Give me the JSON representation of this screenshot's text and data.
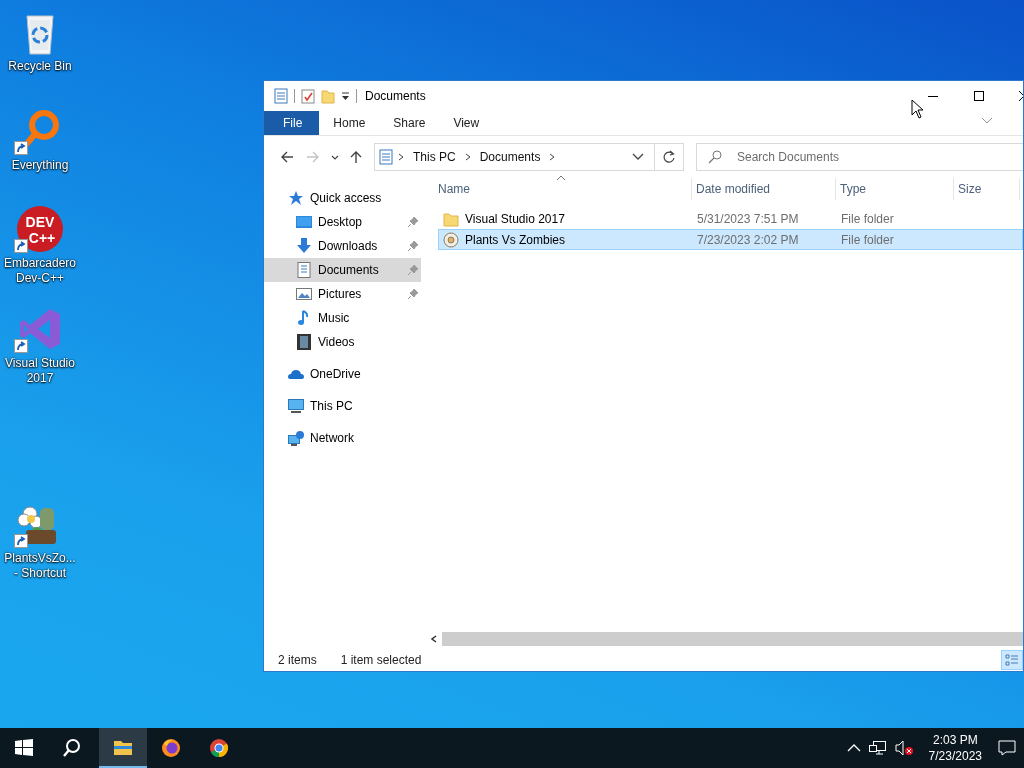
{
  "desktop_icons": [
    {
      "kind": "recycle",
      "label": "Recycle Bin",
      "shortcut": false
    },
    {
      "kind": "ring",
      "label": "Everything",
      "shortcut": true
    },
    {
      "kind": "devcpp",
      "label": "Embarcadero Dev-C++",
      "shortcut": true,
      "logo_text": [
        "DEV",
        "C++"
      ]
    },
    {
      "kind": "vs",
      "label": "Visual Studio 2017",
      "shortcut": true
    },
    {
      "kind": "game",
      "label": "PlantsVsZo... - Shortcut",
      "shortcut": true
    }
  ],
  "explorer": {
    "title": "Documents",
    "ribbon_tabs": [
      {
        "kind": "file",
        "label": "File"
      },
      {
        "kind": "tab",
        "label": "Home"
      },
      {
        "kind": "tab",
        "label": "Share"
      },
      {
        "kind": "tab",
        "label": "View"
      }
    ],
    "nav": {
      "back_disabled": false,
      "forward_disabled": true
    },
    "address": {
      "crumbs": [
        "This PC",
        "Documents"
      ]
    },
    "search": {
      "placeholder": "Search Documents"
    },
    "sidebar": [
      {
        "kind": "star",
        "label": "Quick access",
        "selected": false,
        "children": [
          {
            "kind": "desktop",
            "label": "Desktop",
            "pinned": true,
            "selected": false
          },
          {
            "kind": "download",
            "label": "Downloads",
            "pinned": true,
            "selected": false
          },
          {
            "kind": "document",
            "label": "Documents",
            "pinned": true,
            "selected": true
          },
          {
            "kind": "pictures",
            "label": "Pictures",
            "pinned": true,
            "selected": false
          },
          {
            "kind": "music",
            "label": "Music",
            "pinned": false,
            "selected": false
          },
          {
            "kind": "videos",
            "label": "Videos",
            "pinned": false,
            "selected": false
          }
        ]
      },
      {
        "kind": "cloud",
        "label": "OneDrive",
        "selected": false
      },
      {
        "kind": "pc",
        "label": "This PC",
        "selected": false
      },
      {
        "kind": "network",
        "label": "Network",
        "selected": false
      }
    ],
    "columns": [
      {
        "label": "Name",
        "sorted": true
      },
      {
        "label": "Date modified",
        "sorted": false
      },
      {
        "label": "Type",
        "sorted": false
      },
      {
        "label": "Size",
        "sorted": false
      }
    ],
    "rows": [
      {
        "kind": "folder",
        "name": "Visual Studio 2017",
        "date": "5/31/2023 7:51 PM",
        "type": "File folder",
        "selected": false
      },
      {
        "kind": "game",
        "name": "Plants Vs Zombies",
        "date": "7/23/2023 2:02 PM",
        "type": "File folder",
        "selected": true
      }
    ],
    "status_bar": {
      "item_count": "2 items",
      "selection": "1 item selected"
    },
    "view": {
      "details_selected": true
    }
  },
  "taskbar": {
    "apps": [
      {
        "kind": "start",
        "active": false
      },
      {
        "kind": "search",
        "active": false
      },
      {
        "kind": "explorer",
        "active": true
      },
      {
        "kind": "firefox",
        "active": false
      },
      {
        "kind": "chrome",
        "active": false
      }
    ],
    "volume_muted": true,
    "time": "2:03 PM",
    "date": "7/23/2023"
  }
}
